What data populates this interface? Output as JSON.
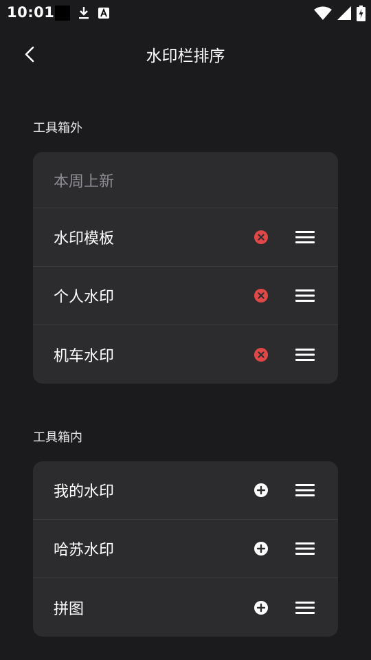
{
  "status_bar": {
    "time": "10:01",
    "icons": [
      "notification-square-icon",
      "download-icon",
      "a-badge-icon",
      "wifi-icon",
      "signal-icon",
      "battery-charging-icon"
    ]
  },
  "header": {
    "title": "水印栏排序",
    "back_icon": "back-arrow-icon"
  },
  "outside_section": {
    "label": "工具箱外",
    "items": [
      {
        "label": "本周上新"
      },
      {
        "label": "水印模板",
        "action_icon": "remove-icon"
      },
      {
        "label": "个人水印",
        "action_icon": "remove-icon"
      },
      {
        "label": "机车水印",
        "action_icon": "remove-icon"
      }
    ]
  },
  "inside_section": {
    "label": "工具箱内",
    "items": [
      {
        "label": "我的水印",
        "action_icon": "add-icon"
      },
      {
        "label": "哈苏水印",
        "action_icon": "add-icon"
      },
      {
        "label": "拼图",
        "action_icon": "add-icon"
      }
    ]
  },
  "colors": {
    "background": "#1b1b1d",
    "card": "#2c2c2e",
    "remove": "#e04848",
    "add": "#ffffff",
    "muted_text": "#8e8e93"
  }
}
